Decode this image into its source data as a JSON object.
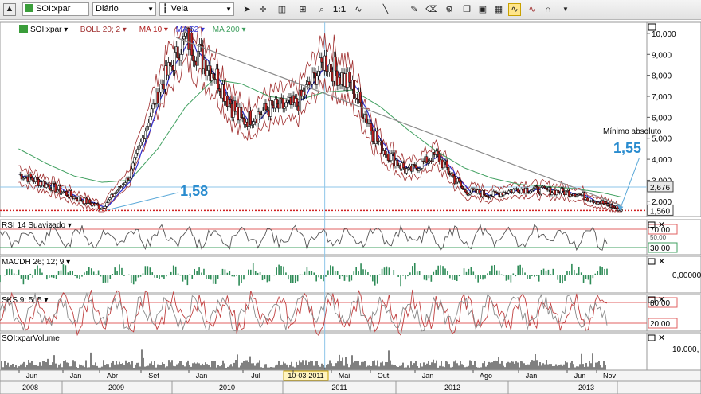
{
  "toolbar": {
    "symbol": "SOI:xpar",
    "period": "Diário",
    "chart_style": "Vela",
    "icons": [
      "window-up-icon",
      "symbol-search-icon",
      "period-dropdown-icon",
      "candle-style-icon",
      "cursor-icon",
      "crosshair-icon",
      "bar-chart-icon",
      "zoom-icon",
      "one-to-one-icon",
      "indicator-icon",
      "trendline-icon",
      "draw-icon",
      "eraser-icon",
      "settings-icon",
      "layers-icon",
      "template-icon",
      "compare-icon",
      "bollinger-toggle-icon",
      "magnet-icon",
      "more-dropdown-icon"
    ]
  },
  "main_panel": {
    "legend": [
      {
        "label": "SOI:xpar",
        "color": "#000000"
      },
      {
        "label": "BOLL 20; 2",
        "color": "#a03030"
      },
      {
        "label": "MA 10",
        "color": "#b02020"
      },
      {
        "label": "MA 52",
        "color": "#3030d0"
      },
      {
        "label": "MA 200",
        "color": "#40a060"
      }
    ],
    "y_ticks": [
      "10,000",
      "9,000",
      "8,000",
      "7,000",
      "6,000",
      "5,000",
      "4,000",
      "3,000",
      "2,000"
    ],
    "current_price_label": "2,676",
    "support_label": "1,560",
    "annotation_low_2009": "1,58",
    "annotation_low_2013_title": "Mínimo absoluto",
    "annotation_low_2013": "1,55"
  },
  "rsi_panel": {
    "label": "RSI 14 Suavizado",
    "levels": [
      "70,00",
      "50,00",
      "30,00"
    ]
  },
  "macd_panel": {
    "label": "MACDH 26; 12; 9",
    "level": "0,00000"
  },
  "sks_panel": {
    "label": "SKS 9; 5; 5",
    "levels": [
      "80,00",
      "20,00"
    ]
  },
  "volume_panel": {
    "label": "SOI:xparVolume",
    "level": "10.000,"
  },
  "x_axis": {
    "months": [
      "Jun",
      "Jan",
      "Abr",
      "Set",
      "Jan",
      "Jul",
      "10-03-2011",
      "Mai",
      "Out",
      "Jan",
      "Ago",
      "Jan",
      "Jun",
      "Nov"
    ],
    "years": [
      "2008",
      "2009",
      "2010",
      "2011",
      "2012",
      "2013"
    ]
  },
  "chart_data": {
    "type": "line",
    "title": "",
    "xlabel": "",
    "ylabel": "",
    "ylim": [
      1.5,
      10.3
    ],
    "x": [
      "2008-06",
      "2008-09",
      "2008-12",
      "2009-03",
      "2009-06",
      "2009-09",
      "2009-12",
      "2010-03",
      "2010-06",
      "2010-09",
      "2010-12",
      "2011-03",
      "2011-06",
      "2011-09",
      "2011-12",
      "2012-03",
      "2012-06",
      "2012-09",
      "2012-12",
      "2013-03",
      "2013-06",
      "2013-09",
      "2013-11"
    ],
    "series": [
      {
        "name": "SOI:xpar",
        "values": [
          3.3,
          2.8,
          2.2,
          1.7,
          3.2,
          7.2,
          9.8,
          8.2,
          5.8,
          6.4,
          6.6,
          8.7,
          7.4,
          4.6,
          3.4,
          4.2,
          2.5,
          2.3,
          2.6,
          2.5,
          2.4,
          1.9,
          1.6
        ]
      },
      {
        "name": "MA 200",
        "values": [
          4.5,
          3.8,
          3.2,
          2.9,
          3.0,
          4.5,
          6.5,
          7.8,
          7.6,
          7.0,
          6.8,
          7.2,
          7.3,
          6.5,
          5.4,
          4.4,
          3.6,
          3.1,
          2.8,
          2.7,
          2.6,
          2.4,
          2.2
        ]
      }
    ],
    "annotations": [
      {
        "text": "1,58",
        "y": 1.58,
        "x": "2009-03"
      },
      {
        "text": "Mínimo absoluto 1,55",
        "y": 1.55,
        "x": "2013-11"
      }
    ],
    "horizontal_lines": [
      2.676,
      1.56
    ],
    "trendline": {
      "from": {
        "x": "2009-11",
        "y": 9.8
      },
      "to": {
        "x": "2013-11",
        "y": 1.8
      }
    }
  }
}
